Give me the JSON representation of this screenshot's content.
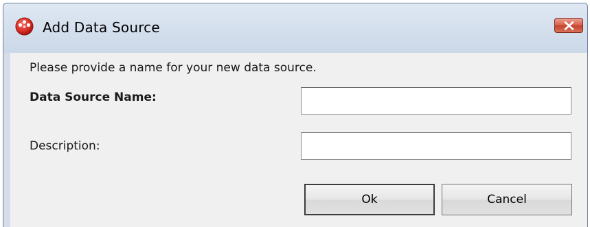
{
  "window": {
    "title": "Add Data Source",
    "icon": "red-sphere-app-icon",
    "close_icon": "close-icon"
  },
  "form": {
    "prompt": "Please provide a name for your new data source.",
    "name_label": "Data Source Name:",
    "name_value": "",
    "description_label": "Description:",
    "description_value": ""
  },
  "buttons": {
    "ok_label": "Ok",
    "cancel_label": "Cancel"
  },
  "colors": {
    "title_bar": "#cbd8e8",
    "client_background": "#f0f0f0",
    "close_button": "#c4422c",
    "app_icon": "#d42c24"
  }
}
